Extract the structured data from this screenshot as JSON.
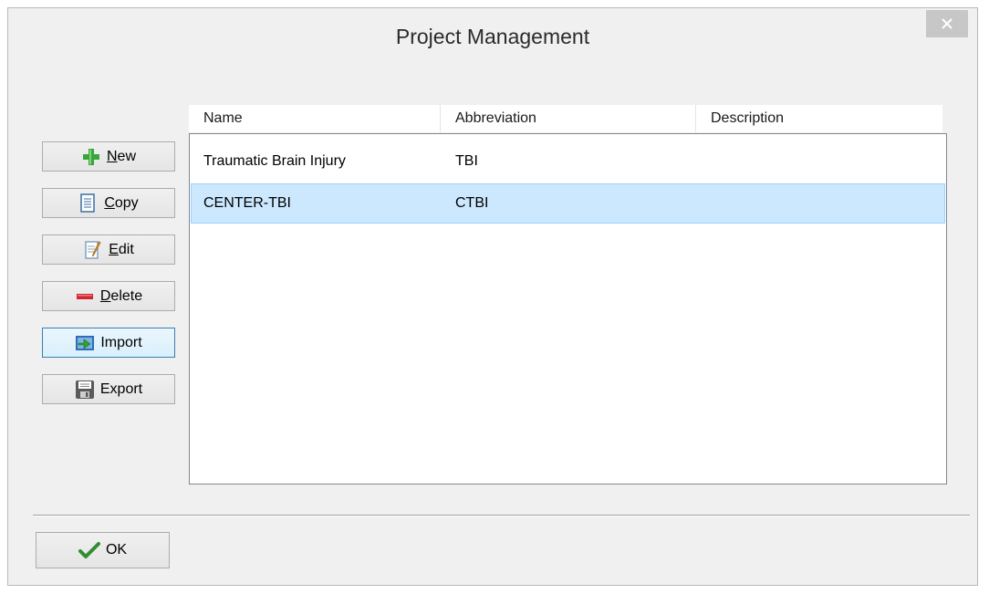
{
  "window": {
    "title": "Project Management"
  },
  "side_buttons": {
    "new": {
      "accel": "N",
      "rest": "ew",
      "icon": "plus-icon"
    },
    "copy": {
      "accel": "C",
      "rest": "opy",
      "icon": "copy-document-icon"
    },
    "edit": {
      "accel": "E",
      "rest": "dit",
      "icon": "edit-notepad-icon"
    },
    "delete": {
      "accel": "D",
      "rest": "elete",
      "icon": "minus-icon"
    },
    "import": {
      "label": "Import",
      "icon": "import-icon"
    },
    "export": {
      "label": "Export",
      "icon": "floppy-disk-icon"
    }
  },
  "list": {
    "columns": [
      "Name",
      "Abbreviation",
      "Description"
    ],
    "rows": [
      {
        "name": "Traumatic Brain Injury",
        "abbreviation": "TBI",
        "description": "",
        "selected": false
      },
      {
        "name": "CENTER-TBI",
        "abbreviation": "CTBI",
        "description": "",
        "selected": true
      }
    ]
  },
  "footer": {
    "ok_label": "OK",
    "ok_icon": "checkmark-icon"
  },
  "colors": {
    "selection_bg": "#cce8ff",
    "selection_border": "#99d1ff",
    "close_button_bg": "#c7c7c7",
    "window_bg": "#f0f0f0"
  }
}
